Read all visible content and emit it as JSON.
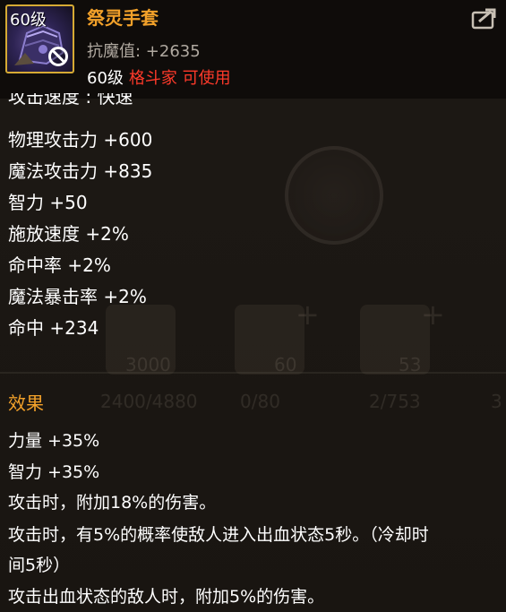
{
  "item": {
    "icon_level": "60级",
    "name": "祭灵手套",
    "resist_label": "抗魔值: +2635",
    "required_level": "60级",
    "required_class": "格斗家 可使用"
  },
  "stats": {
    "partial": "攻击速度 : 快速",
    "lines": [
      "物理攻击力 +600",
      "魔法攻击力 +835",
      "智力 +50",
      "施放速度 +2%",
      "命中率 +2%",
      "魔法暴击率 +2%",
      "命中 +234"
    ]
  },
  "effects": {
    "title": "效果",
    "lines": [
      "力量 +35%",
      "智力 +35%",
      "攻击时，附加18%的伤害。",
      "攻击时，有5%的概率使敌人进入出血状态5秒。（冷却时",
      "间5秒）",
      "攻击出血状态的敌人时，附加5%的伤害。"
    ]
  },
  "background": {
    "slot_values": [
      "3000",
      "60",
      "53"
    ],
    "row_values": [
      "2400/4880",
      "0/80",
      "2/753",
      "3"
    ]
  },
  "colors": {
    "title": "#f2a12a",
    "class_requirement": "#ff3a2a",
    "icon_border": "#d6aa34",
    "resist": "#b0a9a0"
  },
  "icons": {
    "share": "share-export-icon",
    "ban": "not-allowed-icon"
  }
}
